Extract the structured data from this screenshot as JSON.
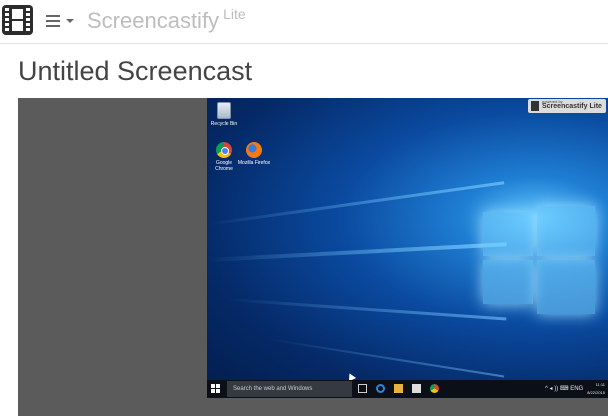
{
  "header": {
    "brand": "Screencastify",
    "edition": "Lite",
    "logo_icon": "film-strip-icon",
    "menu_icon": "hamburger-icon"
  },
  "page": {
    "title": "Untitled Screencast"
  },
  "video": {
    "watermark": {
      "small_text": "powered by",
      "name": "Screencastify Lite"
    },
    "desktop_icons": [
      {
        "label": "Recycle Bin",
        "icon": "recycle-bin-icon"
      },
      {
        "label": "Google Chrome",
        "icon": "chrome-icon"
      },
      {
        "label": "Mozilla Firefox",
        "icon": "firefox-icon"
      }
    ],
    "taskbar": {
      "search_placeholder": "Search the web and Windows",
      "tray_symbols": "^ ◂ )) ⌨ ENG",
      "time": "11:11",
      "date": "8/22/2015"
    }
  },
  "colors": {
    "brand_text": "#bdbdbd",
    "title_text": "#444444",
    "player_bg": "#5b5b5b",
    "taskbar_bg": "#0b0f17"
  }
}
